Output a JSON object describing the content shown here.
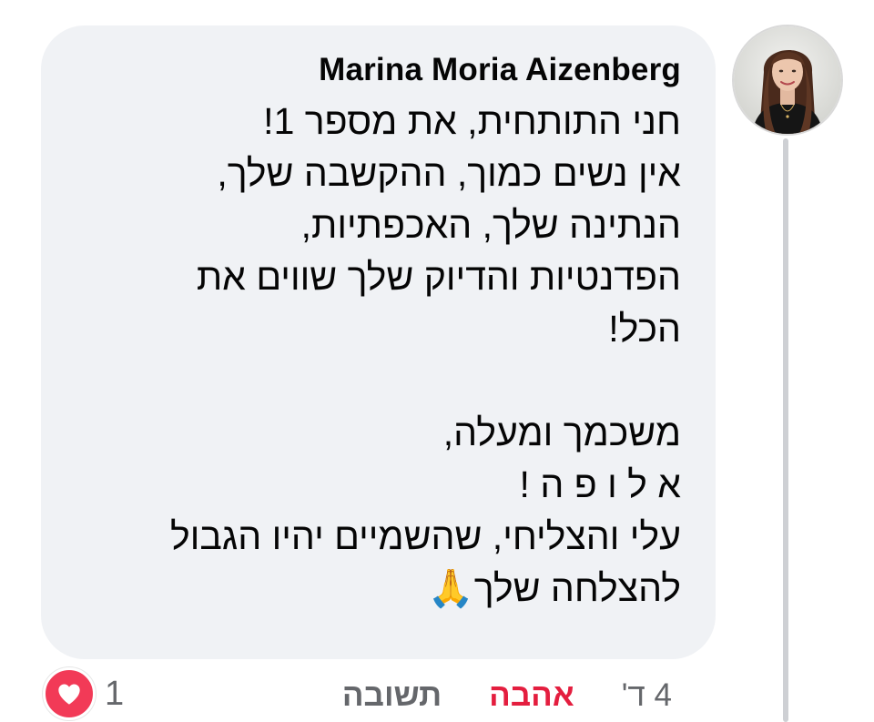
{
  "comment": {
    "author": "Marina Moria Aizenberg",
    "text": "חני התותחית, את מספר 1!\nאין נשים כמוך, ההקשבה שלך,\nהנתינה שלך, האכפתיות,\nהפדנטיות והדיוק שלך שווים את\nהכל!\n\nמשכמך ומעלה,\nא ל ו פ ה !\nעלי והצליחי, שהשמיים יהיו הגבול\nלהצלחה שלך🙏"
  },
  "actions": {
    "time": "4 ד'",
    "love_label": "אהבה",
    "reply_label": "תשובה"
  },
  "reactions": {
    "icon": "heart-icon",
    "count": "1"
  },
  "colors": {
    "bubble_bg": "#f0f2f5",
    "love_red": "#e41e3f",
    "heart_bg": "#f23a57",
    "muted_text": "#65676b"
  }
}
